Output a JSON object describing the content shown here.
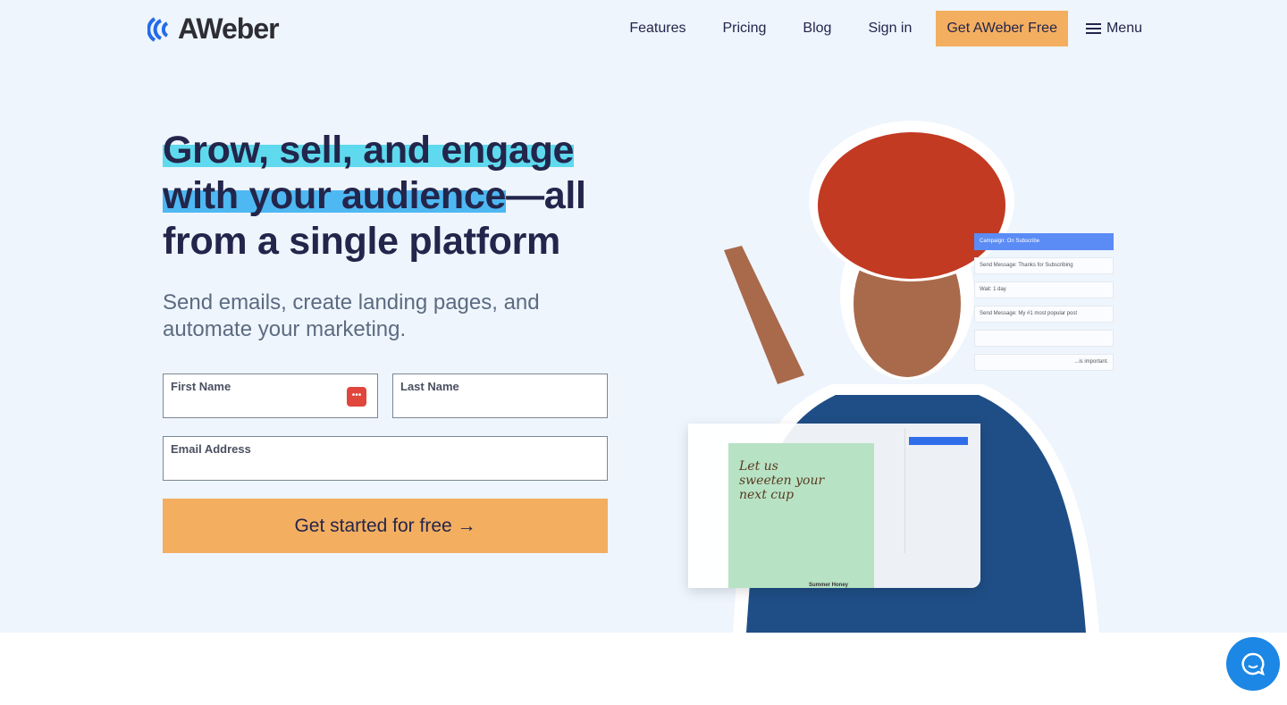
{
  "brand": {
    "name": "AWeber"
  },
  "nav": {
    "items": [
      "Features",
      "Pricing",
      "Blog",
      "Sign in"
    ],
    "cta": "Get AWeber Free",
    "menu": "Menu"
  },
  "hero": {
    "headline_hl1": "Grow, sell, and engage",
    "headline_hl2": "with your audience",
    "headline_rest1": "—all",
    "headline_rest2": "from a single platform",
    "subheadline": "Send emails, create landing pages, and automate your marketing."
  },
  "form": {
    "first_name": "First Name",
    "last_name": "Last Name",
    "email": "Email Address",
    "submit": "Get started for free →"
  },
  "illustration": {
    "workflow": [
      "Campaign: On Subscribe",
      "Send Message: Thanks for Subscribing",
      "Wait: 1 day",
      "Send Message: My #1 most popular post",
      "",
      "...is important."
    ],
    "card_text": "Let us sweeten your next cup",
    "card_caption": "Summer Honey"
  },
  "colors": {
    "accent": "#f4ae60",
    "text": "#23254a",
    "highlight": "#5fd9ee",
    "chat": "#1d87e5"
  }
}
